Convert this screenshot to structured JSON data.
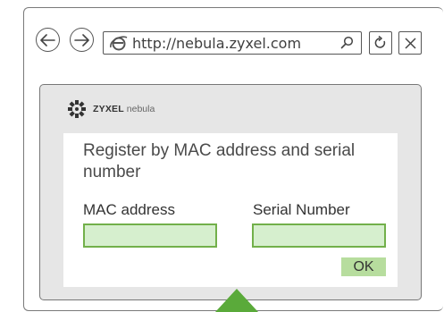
{
  "browser": {
    "url": "http://nebula.zyxel.com",
    "buttons": {
      "back": "back-arrow-icon",
      "forward": "forward-arrow-icon",
      "refresh": "refresh-icon",
      "close": "close-icon",
      "search": "search-icon"
    }
  },
  "app": {
    "brand_bold": "ZYXEL",
    "brand_light": "nebula"
  },
  "form": {
    "title": "Register by MAC address and serial number",
    "mac_label": "MAC address",
    "mac_value": "",
    "serial_label": "Serial Number",
    "serial_value": "",
    "ok_label": "OK"
  },
  "colors": {
    "input_fill": "#d6efce",
    "input_border": "#72b04a",
    "ok_button": "#b7dd9e",
    "pointer": "#5aaa3a",
    "panel": "#e6e6e6"
  }
}
